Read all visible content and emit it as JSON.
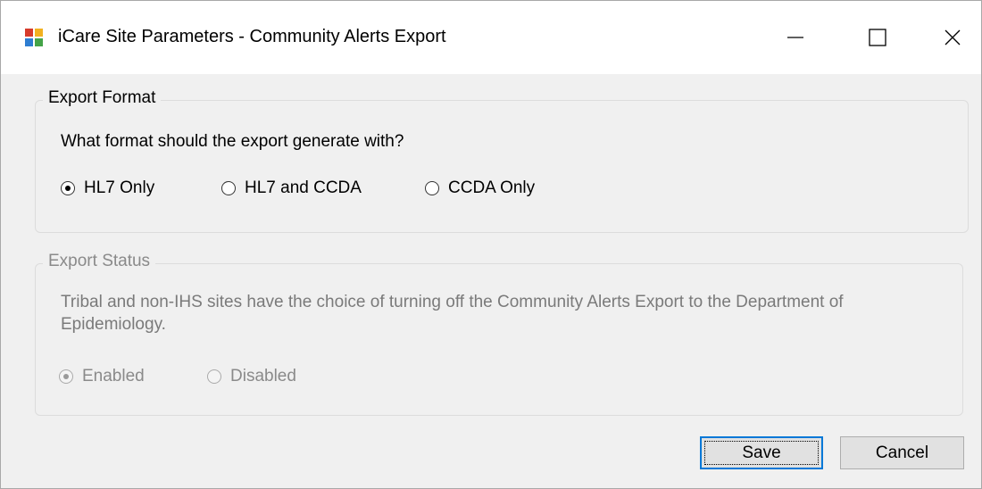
{
  "window": {
    "title": "iCare Site Parameters - Community Alerts Export",
    "controls": {
      "minimize": "minimize-icon",
      "maximize": "maximize-icon",
      "close": "close-icon"
    }
  },
  "export_format": {
    "legend": "Export Format",
    "question": "What format should the export generate with?",
    "options": [
      {
        "label": "HL7 Only",
        "checked": true
      },
      {
        "label": "HL7 and CCDA",
        "checked": false
      },
      {
        "label": "CCDA Only",
        "checked": false
      }
    ]
  },
  "export_status": {
    "legend": "Export Status",
    "description": "Tribal and non-IHS sites have the choice of turning off the Community Alerts Export to the Department of Epidemiology.",
    "enabled_state": false,
    "options": [
      {
        "label": "Enabled",
        "checked": true
      },
      {
        "label": "Disabled",
        "checked": false
      }
    ]
  },
  "buttons": {
    "save": "Save",
    "cancel": "Cancel"
  },
  "colors": {
    "focus_border": "#0078d7",
    "disabled_text": "#8a8a8a"
  }
}
